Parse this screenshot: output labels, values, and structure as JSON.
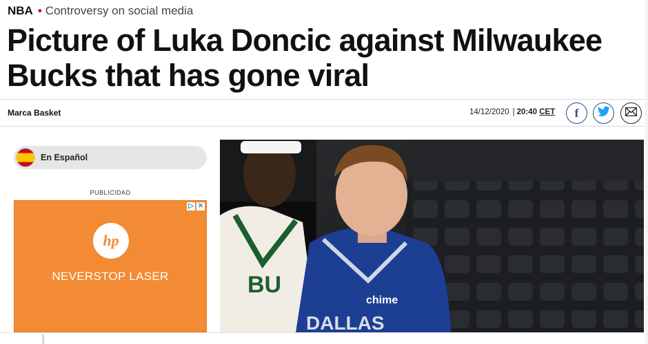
{
  "kicker": {
    "section": "NBA",
    "topic": "Controversy on social media"
  },
  "headline": "Picture of Luka Doncic against Milwaukee Bucks that has gone viral",
  "byline": {
    "author": "Marca Basket",
    "date": "14/12/2020",
    "separator": "|",
    "time": "20:40",
    "timezone": "CET"
  },
  "share": [
    {
      "name": "facebook-icon",
      "glyph": "f"
    },
    {
      "name": "twitter-icon"
    },
    {
      "name": "email-icon"
    }
  ],
  "language": {
    "label": "En Español",
    "flag": "spain-flag-icon"
  },
  "advertisement": {
    "label": "PUBLICIDAD",
    "brand": "hp",
    "tagline": "NEVERSTOP LASER",
    "background": "#f28b33"
  },
  "photo": {
    "jersey_front": "DALLAS",
    "jersey_sponsor": "chime",
    "opponent_jersey": "BU"
  },
  "colors": {
    "accent_red": "#d0021b",
    "share_blue": "#2b4a7f",
    "twitter_blue": "#1da1f2"
  }
}
